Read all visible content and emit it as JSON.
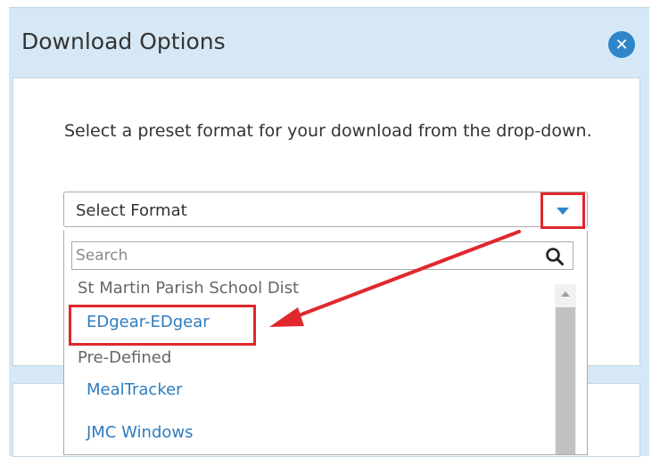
{
  "dialog": {
    "title": "Download Options",
    "close_icon": "close-icon"
  },
  "instructions": "Select a preset format for your download from the drop-down.",
  "format_select": {
    "value": "Select Format",
    "caret_icon": "chevron-down-icon"
  },
  "dropdown": {
    "search_placeholder": "Search",
    "search_value": "",
    "search_icon": "search-icon",
    "options": [
      {
        "label": "St Martin Parish School Dist",
        "type": "group"
      },
      {
        "label": "EDgear-EDgear",
        "type": "item",
        "highlighted": true
      },
      {
        "label": "Pre-Defined",
        "type": "group"
      },
      {
        "label": "MealTracker",
        "type": "item"
      },
      {
        "label": "JMC Windows",
        "type": "item"
      }
    ]
  },
  "annotations": {
    "highlight_color": "#e0282e",
    "arrow_color": "#e0282e"
  },
  "colors": {
    "dialog_bg": "#d6e8f5",
    "accent": "#2e86c9",
    "link": "#2e7cbf"
  }
}
